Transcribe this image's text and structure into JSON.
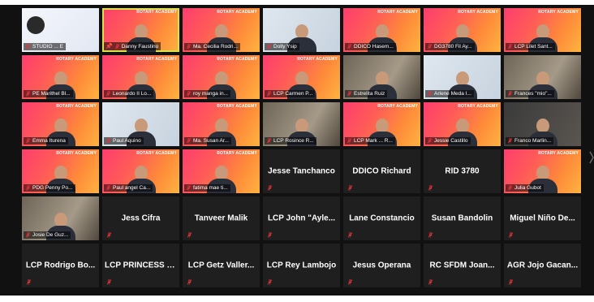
{
  "banner_text": "ROTARY ACADEMY",
  "tiles": [
    {
      "name": "STUDIO ... E",
      "kind": "slide"
    },
    {
      "name": "Danny Faustino",
      "kind": "video",
      "speaking": true,
      "pinned": true
    },
    {
      "name": "Ma. Cecilia Rodri...",
      "kind": "video"
    },
    {
      "name": "Dolly Ysip",
      "kind": "pale"
    },
    {
      "name": "DDICO Hasem...",
      "kind": "video"
    },
    {
      "name": "DG3780 Fil Ay...",
      "kind": "video"
    },
    {
      "name": "LCP Lilet Sant...",
      "kind": "video"
    },
    {
      "name": "PE Marithel Bl...",
      "kind": "video"
    },
    {
      "name": "Leonardo II Lo...",
      "kind": "video"
    },
    {
      "name": "roy manga in...",
      "kind": "video"
    },
    {
      "name": "LCP Carmen P...",
      "kind": "video"
    },
    {
      "name": "Estrelita Ruiz",
      "kind": "room"
    },
    {
      "name": "Arlene Meda I...",
      "kind": "pale"
    },
    {
      "name": "Frances \"mio\"...",
      "kind": "room"
    },
    {
      "name": "Emma Iturena",
      "kind": "video"
    },
    {
      "name": "Paul Aquino",
      "kind": "pale"
    },
    {
      "name": "Ma. Susan Ar...",
      "kind": "video"
    },
    {
      "name": "LCP Rosince R...",
      "kind": "room"
    },
    {
      "name": "LCP Mark ... R...",
      "kind": "video"
    },
    {
      "name": "Jessie Castillo",
      "kind": "video"
    },
    {
      "name": "Franco Marlin...",
      "kind": "dark"
    },
    {
      "name": "PDG Penny Po...",
      "kind": "video"
    },
    {
      "name": "Paul angel Ca...",
      "kind": "video"
    },
    {
      "name": "fatima mae ti...",
      "kind": "video"
    },
    {
      "name": "Jesse Tanchanco",
      "kind": "name"
    },
    {
      "name": "DDICO Richard",
      "kind": "name"
    },
    {
      "name": "RID 3780",
      "kind": "name"
    },
    {
      "name": "Julia Gubot",
      "kind": "video"
    },
    {
      "name": "Josie De Guz...",
      "kind": "poster"
    },
    {
      "name": "Jess Cifra",
      "kind": "name"
    },
    {
      "name": "Tanveer Malik",
      "kind": "name"
    },
    {
      "name": "LCP John \"Ayle...",
      "kind": "name"
    },
    {
      "name": "Lane Constancio",
      "kind": "name"
    },
    {
      "name": "Susan Bandolin",
      "kind": "name"
    },
    {
      "name": "Miguel Niño De...",
      "kind": "name"
    },
    {
      "name": "LCP Rodrigo Bo...",
      "kind": "name"
    },
    {
      "name": "LCP PRINCESS F...",
      "kind": "name"
    },
    {
      "name": "LCP Getz Valler...",
      "kind": "name"
    },
    {
      "name": "LCP Rey Lambojo",
      "kind": "name"
    },
    {
      "name": "Jesus Operana",
      "kind": "name"
    },
    {
      "name": "RC SFDM Joan...",
      "kind": "name"
    },
    {
      "name": "AGR Jojo Gacan...",
      "kind": "name"
    }
  ],
  "colors": {
    "muted": "#e8323c",
    "speaking": "#d9e24a"
  },
  "icons": {
    "muted": "microphone-muted-icon",
    "pin": "pin-icon",
    "next": "chevron-right-icon"
  }
}
